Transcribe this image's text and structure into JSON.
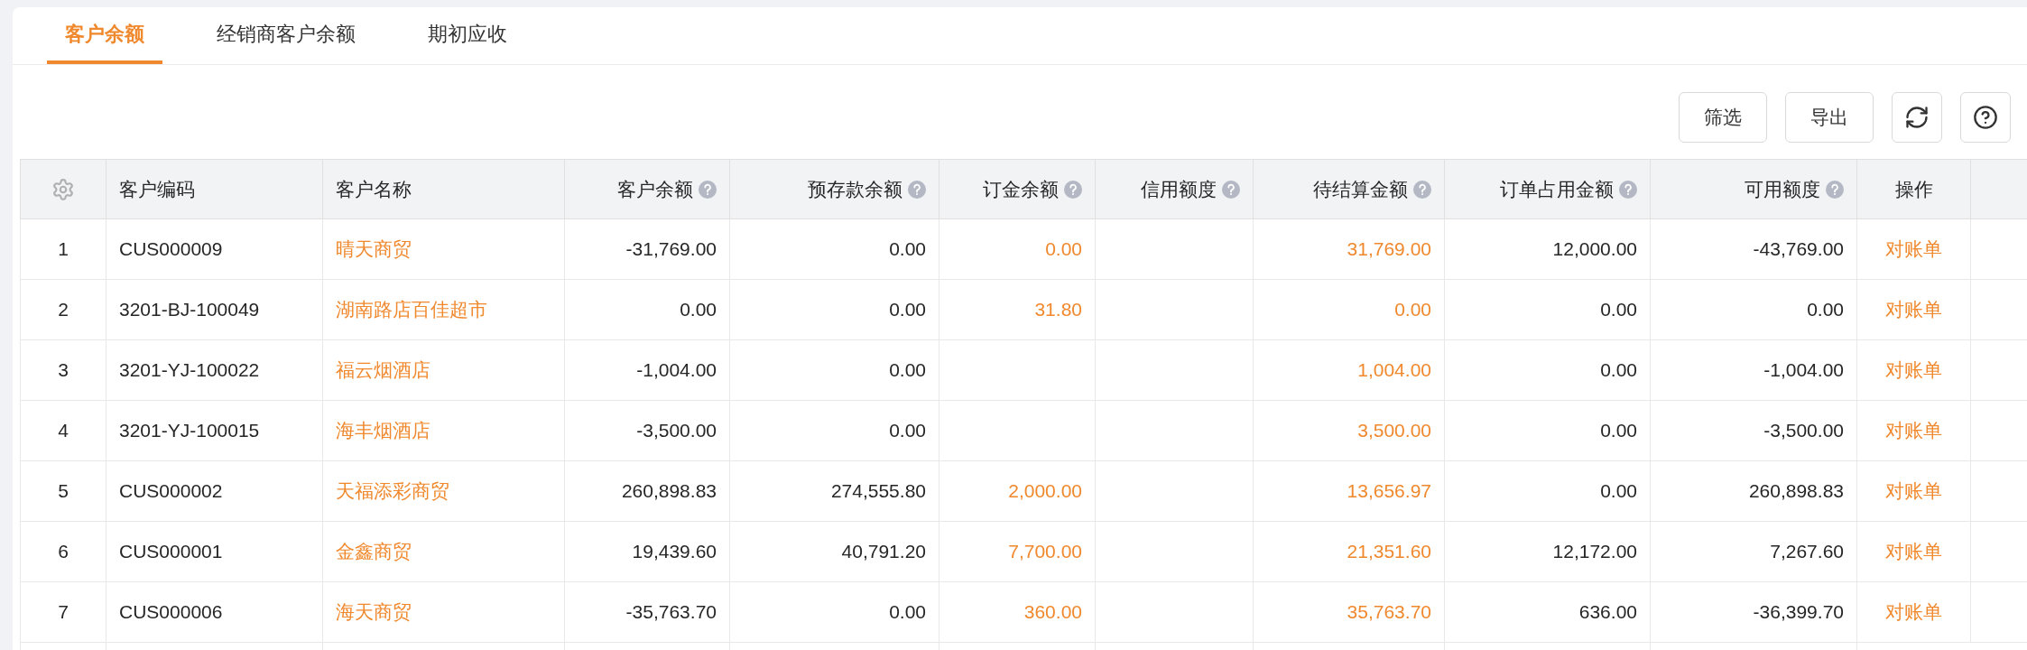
{
  "tabs": [
    {
      "label": "客户余额",
      "selected": true
    },
    {
      "label": "经销商客户余额",
      "selected": false
    },
    {
      "label": "期初应收",
      "selected": false
    }
  ],
  "toolbar": {
    "buttons": [
      {
        "kind": "text",
        "label": "筛选"
      },
      {
        "kind": "text",
        "label": "导出"
      },
      {
        "kind": "refresh"
      },
      {
        "kind": "help"
      }
    ]
  },
  "table": {
    "columns": [
      {
        "kind": "settings"
      },
      {
        "kind": "text",
        "label": "客户编码",
        "help": false
      },
      {
        "kind": "link",
        "label": "客户名称",
        "help": false
      },
      {
        "kind": "number",
        "label": "客户余额",
        "help": true
      },
      {
        "kind": "number",
        "label": "预存款余额",
        "help": true
      },
      {
        "kind": "link_number",
        "label": "订金余额",
        "help": true
      },
      {
        "kind": "number",
        "label": "信用额度",
        "help": true
      },
      {
        "kind": "link_number",
        "label": "待结算金额",
        "help": true
      },
      {
        "kind": "number",
        "label": "订单占用金额",
        "help": true
      },
      {
        "kind": "number",
        "label": "可用额度",
        "help": true
      },
      {
        "kind": "action",
        "label": "操作",
        "help": false
      }
    ],
    "rows": [
      {
        "cells": [
          "1",
          "CUS000009",
          "晴天商贸",
          "-31,769.00",
          "0.00",
          "0.00",
          null,
          "31,769.00",
          "12,000.00",
          "-43,769.00",
          "对账单"
        ]
      },
      {
        "cells": [
          "2",
          "3201-BJ-100049",
          "湖南路店百佳超市",
          "0.00",
          "0.00",
          "31.80",
          null,
          "0.00",
          "0.00",
          "0.00",
          "对账单"
        ]
      },
      {
        "cells": [
          "3",
          "3201-YJ-100022",
          "福云烟酒店",
          "-1,004.00",
          "0.00",
          null,
          null,
          "1,004.00",
          "0.00",
          "-1,004.00",
          "对账单"
        ]
      },
      {
        "cells": [
          "4",
          "3201-YJ-100015",
          "海丰烟酒店",
          "-3,500.00",
          "0.00",
          null,
          null,
          "3,500.00",
          "0.00",
          "-3,500.00",
          "对账单"
        ]
      },
      {
        "cells": [
          "5",
          "CUS000002",
          "天福添彩商贸",
          "260,898.83",
          "274,555.80",
          "2,000.00",
          null,
          "13,656.97",
          "0.00",
          "260,898.83",
          "对账单"
        ]
      },
      {
        "cells": [
          "6",
          "CUS000001",
          "金鑫商贸",
          "19,439.60",
          "40,791.20",
          "7,700.00",
          null,
          "21,351.60",
          "12,172.00",
          "7,267.60",
          "对账单"
        ]
      },
      {
        "cells": [
          "7",
          "CUS000006",
          "海天商贸",
          "-35,763.70",
          "0.00",
          "360.00",
          null,
          "35,763.70",
          "636.00",
          "-36,399.70",
          "对账单"
        ]
      }
    ]
  }
}
